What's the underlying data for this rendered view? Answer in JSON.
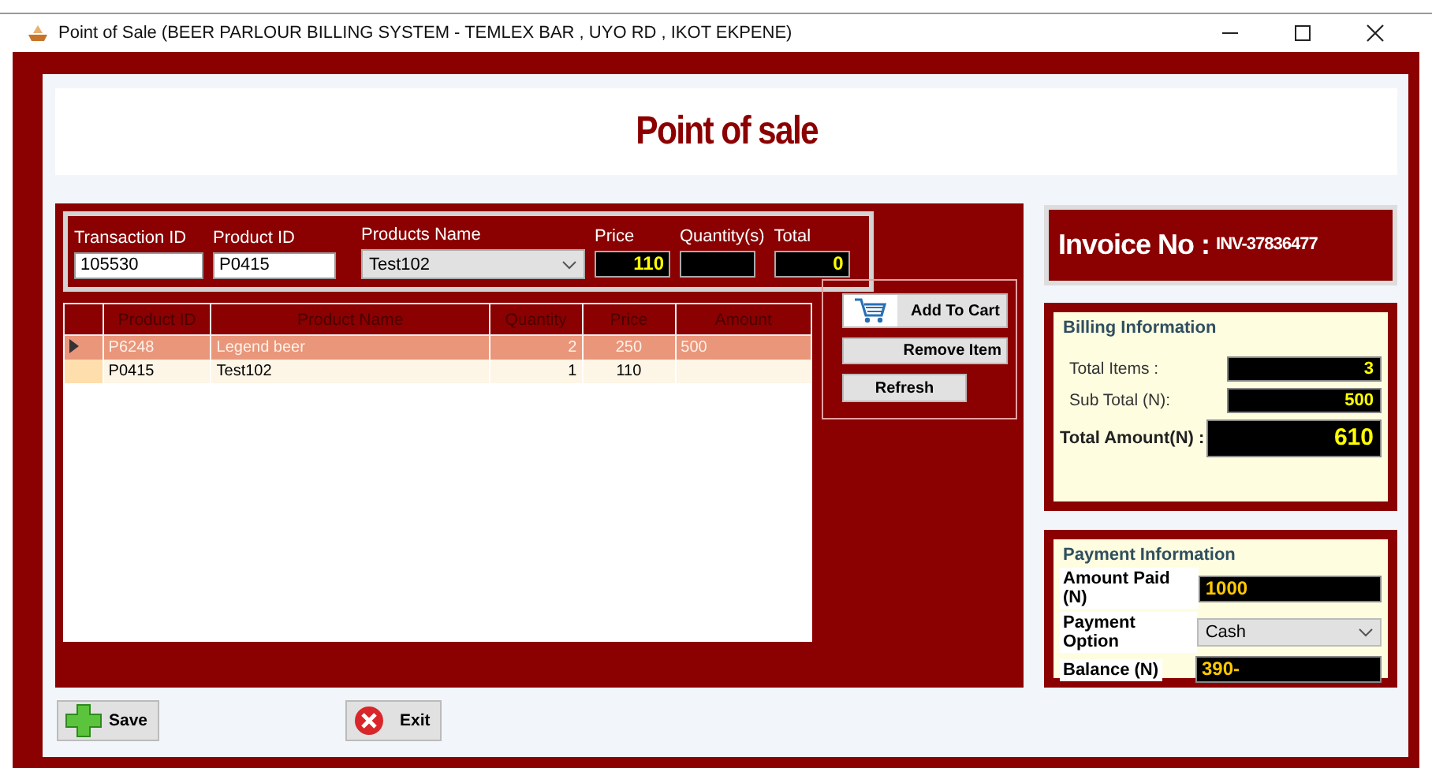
{
  "window": {
    "title": "Point of Sale (BEER PARLOUR BILLING SYSTEM - TEMLEX BAR , UYO RD , IKOT EKPENE)"
  },
  "header": {
    "title": "Point of sale"
  },
  "entry_fields": [
    {
      "kind": "text",
      "label": "Transaction ID",
      "value": "105530"
    },
    {
      "kind": "text",
      "label": "Product ID",
      "value": "P0415"
    },
    {
      "kind": "combo",
      "label": "Products Name",
      "value": "Test102"
    },
    {
      "kind": "display",
      "label": "Price",
      "value": "110"
    },
    {
      "kind": "display",
      "label": "Quantity(s)"
    },
    {
      "kind": "display",
      "label": "Total",
      "value": "0"
    }
  ],
  "table": {
    "columns": [
      "Product ID",
      "Product Name",
      "Quantity",
      "Price",
      "Amount"
    ],
    "rows": [
      {
        "selected": true,
        "cells": [
          "P6248",
          "Legend beer",
          "2",
          "250",
          "500"
        ]
      },
      {
        "selected": false,
        "cells": [
          "P0415",
          "Test102",
          "1",
          "110",
          ""
        ]
      }
    ]
  },
  "cart_buttons": [
    {
      "kind": "cart",
      "label": "Add To Cart"
    },
    {
      "kind": "plain",
      "label": "Remove Item"
    },
    {
      "kind": "small",
      "label": "Refresh"
    }
  ],
  "invoice": {
    "label": "Invoice No :",
    "number": "INV-37836477"
  },
  "billing": {
    "title": "Billing Information",
    "rows": [
      {
        "kind": "small",
        "label": "Total Items :",
        "value": "3"
      },
      {
        "kind": "small",
        "label": "Sub Total (N):",
        "value": "500"
      },
      {
        "kind": "large",
        "label": "Total Amount(N) :",
        "value": "610"
      }
    ]
  },
  "payment": {
    "title": "Payment Information",
    "rows": [
      {
        "kind": "field",
        "label": "Amount Paid (N)",
        "value": "1000"
      },
      {
        "kind": "combo",
        "label": "Payment Option",
        "value": "Cash"
      },
      {
        "kind": "field",
        "label": "Balance (N)",
        "value": "390-"
      }
    ]
  },
  "footer_buttons": [
    {
      "kind": "save",
      "label": "Save"
    },
    {
      "kind": "exit",
      "label": "Exit"
    }
  ]
}
